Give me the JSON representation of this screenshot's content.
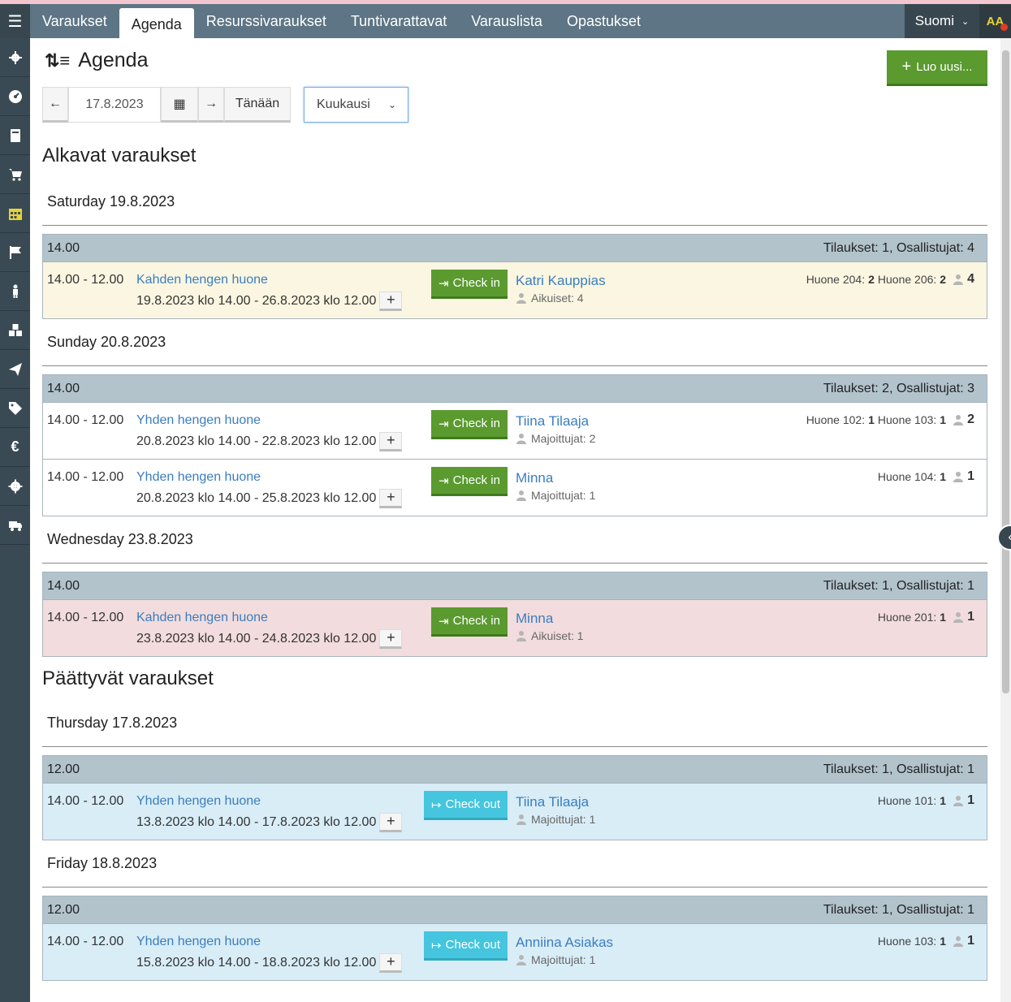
{
  "nav": {
    "menu_icon": "hamburger-icon",
    "tabs": [
      "Varaukset",
      "Agenda",
      "Resurssivaraukset",
      "Tuntivarattavat",
      "Varauslista",
      "Opastukset"
    ],
    "language": "Suomi",
    "text_size": "AA"
  },
  "sidebar": {
    "icons": [
      "gears-icon",
      "dashboard-icon",
      "book-icon",
      "cart-icon",
      "calendar-icon",
      "flag-icon",
      "person-icon",
      "cubes-icon",
      "send-icon",
      "tag-icon",
      "euro-icon",
      "settings-icon",
      "truck-icon"
    ]
  },
  "header": {
    "title": "Agenda",
    "new_button": "Luo uusi...",
    "date": "17.8.2023",
    "today": "Tänään",
    "period": "Kuukausi"
  },
  "starting": {
    "title": "Alkavat varaukset",
    "days": [
      {
        "label": "Saturday 19.8.2023",
        "time": "14.00",
        "summary": "Tilaukset: 1, Osallistujat: 4",
        "rows": [
          {
            "time": "14.00 - 12.00",
            "room": "Kahden hengen huone",
            "range": "19.8.2023 klo 14.00 - 26.8.2023 klo 12.00",
            "action": "Check in",
            "guest": "Katri Kauppias",
            "people": "Aikuiset: 4",
            "rooms": [
              {
                "name": "Huone 204:",
                "qty": "2"
              },
              {
                "name": "Huone 206:",
                "qty": "2"
              }
            ],
            "count": "4"
          }
        ]
      },
      {
        "label": "Sunday 20.8.2023",
        "time": "14.00",
        "summary": "Tilaukset: 2, Osallistujat: 3",
        "rows": [
          {
            "time": "14.00 - 12.00",
            "room": "Yhden hengen huone",
            "range": "20.8.2023 klo 14.00 - 22.8.2023 klo 12.00",
            "action": "Check in",
            "guest": "Tiina Tilaaja",
            "people": "Majoittujat: 2",
            "rooms": [
              {
                "name": "Huone 102:",
                "qty": "1"
              },
              {
                "name": "Huone 103:",
                "qty": "1"
              }
            ],
            "count": "2"
          },
          {
            "time": "14.00 - 12.00",
            "room": "Yhden hengen huone",
            "range": "20.8.2023 klo 14.00 - 25.8.2023 klo 12.00",
            "action": "Check in",
            "guest": "Minna",
            "people": "Majoittujat: 1",
            "rooms": [
              {
                "name": "Huone 104:",
                "qty": "1"
              }
            ],
            "count": "1"
          }
        ]
      },
      {
        "label": "Wednesday 23.8.2023",
        "time": "14.00",
        "summary": "Tilaukset: 1, Osallistujat: 1",
        "rows": [
          {
            "time": "14.00 - 12.00",
            "room": "Kahden hengen huone",
            "range": "23.8.2023 klo 14.00 - 24.8.2023 klo 12.00",
            "action": "Check in",
            "guest": "Minna",
            "people": "Aikuiset: 1",
            "rooms": [
              {
                "name": "Huone 201:",
                "qty": "1"
              }
            ],
            "count": "1"
          }
        ]
      }
    ]
  },
  "ending": {
    "title": "Päättyvät varaukset",
    "days": [
      {
        "label": "Thursday 17.8.2023",
        "time": "12.00",
        "summary": "Tilaukset: 1, Osallistujat: 1",
        "rows": [
          {
            "time": "14.00 - 12.00",
            "room": "Yhden hengen huone",
            "range": "13.8.2023 klo 14.00 - 17.8.2023 klo 12.00",
            "action": "Check out",
            "guest": "Tiina Tilaaja",
            "people": "Majoittujat: 1",
            "rooms": [
              {
                "name": "Huone 101:",
                "qty": "1"
              }
            ],
            "count": "1"
          }
        ]
      },
      {
        "label": "Friday 18.8.2023",
        "time": "12.00",
        "summary": "Tilaukset: 1, Osallistujat: 1",
        "rows": [
          {
            "time": "14.00 - 12.00",
            "room": "Yhden hengen huone",
            "range": "15.8.2023 klo 14.00 - 18.8.2023 klo 12.00",
            "action": "Check out",
            "guest": "Anniina Asiakas",
            "people": "Majoittujat: 1",
            "rooms": [
              {
                "name": "Huone 103:",
                "qty": "1"
              }
            ],
            "count": "1"
          }
        ]
      }
    ]
  },
  "colors": {
    "nav_bg": "#5d7584",
    "sidebar_bg": "#3a4a54",
    "link": "#3b7dbf",
    "check_in": "#5a9a2f",
    "check_out": "#45c5de",
    "row_today": "#fbf6e1",
    "row_past": "#f2dcdd",
    "row_ending": "#d9edf7"
  }
}
